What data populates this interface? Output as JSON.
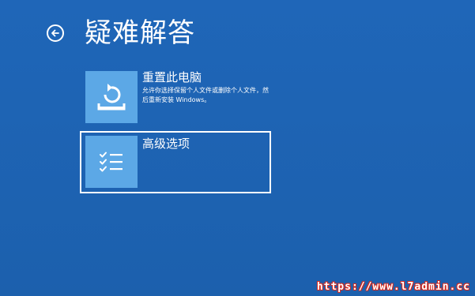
{
  "header": {
    "title": "疑难解答",
    "back_icon": "back-arrow-icon"
  },
  "options": [
    {
      "title": "重置此电脑",
      "description": "允许你选择保留个人文件或删除个人文件，然后重新安装 Windows。",
      "icon": "reset-pc-icon",
      "selected": false
    },
    {
      "title": "高级选项",
      "description": "",
      "icon": "checklist-icon",
      "selected": true
    }
  ],
  "watermark": "https://www.l7admin.cc",
  "colors": {
    "background": "#1e65b5",
    "tile": "#5ca8e6",
    "text": "#ffffff"
  }
}
